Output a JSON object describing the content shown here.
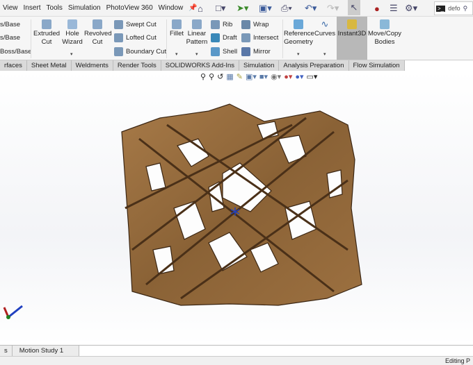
{
  "menu": [
    "View",
    "Insert",
    "Tools",
    "Simulation",
    "PhotoView 360",
    "Window"
  ],
  "search": {
    "value": "defo"
  },
  "ribbon": {
    "left_partial": [
      "s/Base",
      "s/Base",
      "Boss/Base"
    ],
    "extruded_cut": "Extruded Cut",
    "hole_wizard": "Hole Wizard",
    "revolved_cut": "Revolved Cut",
    "swept_cut": "Swept Cut",
    "lofted_cut": "Lofted Cut",
    "boundary_cut": "Boundary Cut",
    "fillet": "Fillet",
    "linear_pattern": "Linear Pattern",
    "rib": "Rib",
    "draft": "Draft",
    "shell": "Shell",
    "wrap": "Wrap",
    "intersect": "Intersect",
    "mirror": "Mirror",
    "reference_geometry": "Reference Geometry",
    "curves": "Curves",
    "instant3d": "Instant3D",
    "move_copy": "Move/Copy Bodies"
  },
  "tabs": [
    "rfaces",
    "Sheet Metal",
    "Weldments",
    "Render Tools",
    "SOLIDWORKS Add-Ins",
    "Simulation",
    "Analysis Preparation",
    "Flow Simulation"
  ],
  "bottom_tabs": [
    "s",
    "Motion Study 1"
  ],
  "status": "Editing P",
  "colors": {
    "wood": "#8a6236",
    "accent_selected": "#b8b8b8"
  }
}
